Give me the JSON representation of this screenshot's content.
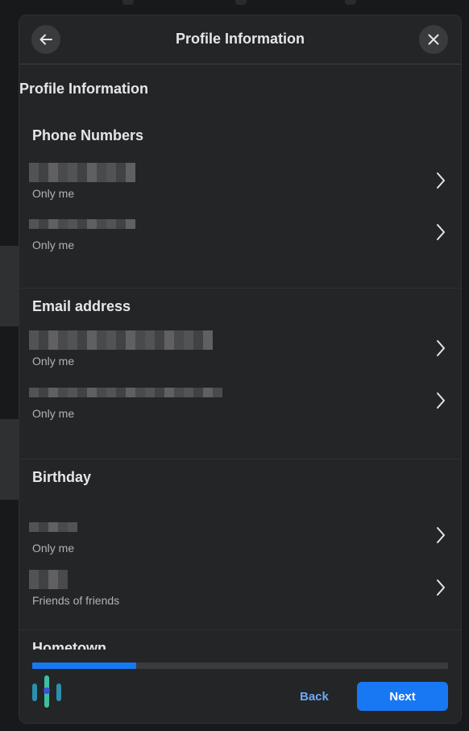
{
  "modal": {
    "title": "Profile Information",
    "back_icon": "arrow-left-icon",
    "close_icon": "close-icon"
  },
  "content": {
    "page_heading": "Profile Information",
    "sections": [
      {
        "heading": "Phone Numbers",
        "items": [
          {
            "privacy": "Only me"
          },
          {
            "privacy": "Only me"
          }
        ]
      },
      {
        "heading": "Email address",
        "items": [
          {
            "privacy": "Only me"
          },
          {
            "privacy": "Only me"
          }
        ]
      },
      {
        "heading": "Birthday",
        "items": [
          {
            "privacy": "Only me"
          },
          {
            "privacy": "Friends of friends"
          }
        ]
      },
      {
        "heading": "Hometown",
        "items": []
      }
    ]
  },
  "footer": {
    "progress": 0.25,
    "back_label": "Back",
    "next_label": "Next"
  },
  "colors": {
    "accent": "#1877f2",
    "background": "#242526"
  }
}
